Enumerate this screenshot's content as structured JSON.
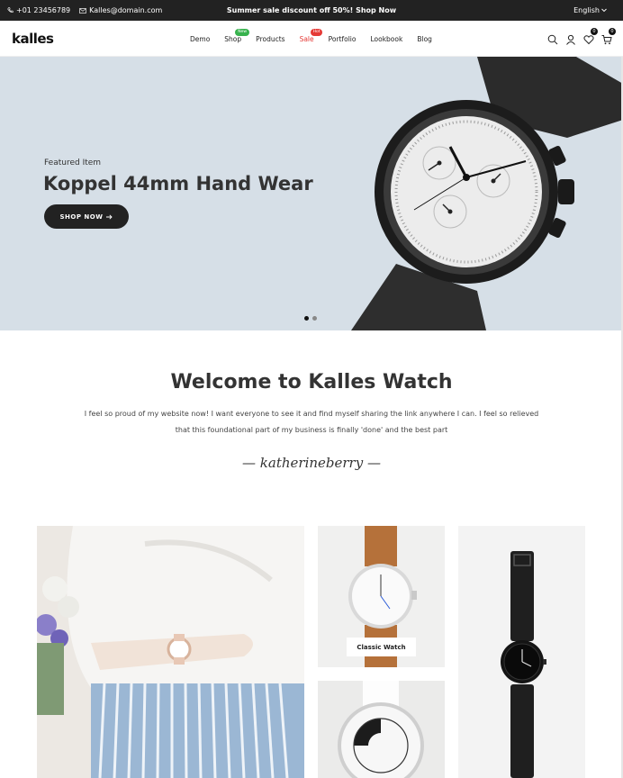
{
  "topbar": {
    "phone": "+01 23456789",
    "email": "Kalles@domain.com",
    "promo": "Summer sale discount off 50%! Shop Now",
    "language": "English"
  },
  "header": {
    "logo": "kalles",
    "nav": [
      {
        "label": "Demo"
      },
      {
        "label": "Shop",
        "badge": "New"
      },
      {
        "label": "Products"
      },
      {
        "label": "Sale",
        "badge": "Hot"
      },
      {
        "label": "Portfolio"
      },
      {
        "label": "Lookbook"
      },
      {
        "label": "Blog"
      }
    ],
    "wishlist_count": "0",
    "cart_count": "0"
  },
  "hero": {
    "eyebrow": "Featured Item",
    "title": "Koppel 44mm Hand Wear",
    "cta": "SHOP NOW",
    "slide_count": 2,
    "active_slide": 1
  },
  "welcome": {
    "title": "Welcome to Kalles Watch",
    "text": "I feel so proud of my website now! I want everyone to see it and find myself sharing the link anywhere I can. I feel so relieved that this foundational part of my business is finally 'done' and the best part",
    "signature": "— katherineberry —"
  },
  "gallery": {
    "label": "Classic Watch"
  },
  "colors": {
    "topbar_bg": "#222222",
    "hero_bg": "#d6dfe7",
    "badge_new": "#37b24d",
    "badge_hot": "#e53935"
  }
}
